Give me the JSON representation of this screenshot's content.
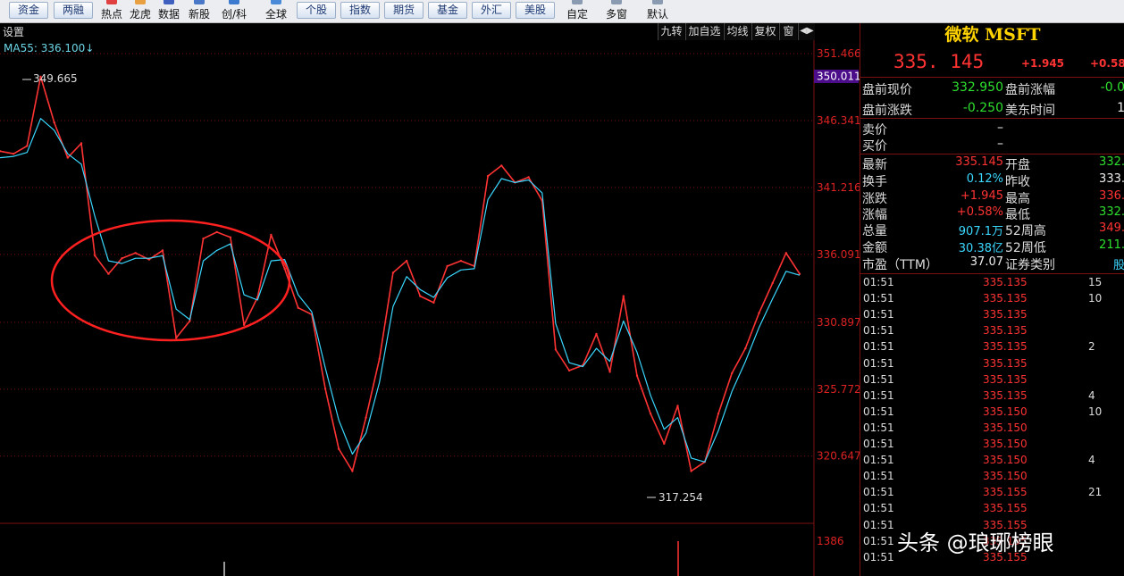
{
  "toolbar": {
    "buttons": [
      "资金",
      "两融"
    ],
    "icons": [
      {
        "label": "热点",
        "icon": "hotspot-icon",
        "color": "#e04040"
      },
      {
        "label": "龙虎",
        "icon": "dragon-tiger-icon",
        "color": "#e8a040"
      },
      {
        "label": "数据",
        "icon": "data-icon",
        "color": "#4060c0"
      },
      {
        "label": "新股",
        "icon": "new-stock-icon",
        "color": "#4a78c8"
      },
      {
        "label": "创/科",
        "icon": "tech-board-icon",
        "color": "#3c7ad0"
      },
      {
        "label": "全球",
        "icon": "globe-icon",
        "color": "#4a8ad8"
      }
    ],
    "market_buttons": [
      "个股",
      "指数",
      "期货",
      "基金",
      "外汇",
      "美股"
    ],
    "right_icons": [
      {
        "label": "自定",
        "icon": "custom-icon"
      },
      {
        "label": "多窗",
        "icon": "multi-window-icon"
      },
      {
        "label": "默认",
        "icon": "default-icon"
      }
    ]
  },
  "chart": {
    "settings_label": "设置",
    "ma_label": "MA55: 336.100↓",
    "controls": [
      "九转",
      "加自选",
      "均线",
      "复权",
      "窗",
      "◀▶"
    ],
    "high_marker": "349.665",
    "low_marker": "317.254",
    "y_tick_labels": [
      "351.466",
      "346.341",
      "341.216",
      "336.091",
      "330.897",
      "325.772",
      "320.647"
    ],
    "current_price_tag": "350.011",
    "volume_label": "1386",
    "colors": {
      "up": "#ff3333",
      "ma": "#3ad8ff",
      "grid": "#7a0f0f",
      "circle": "#ff2020"
    }
  },
  "chart_data": {
    "type": "line",
    "y_axis_ticks": [
      351.466,
      346.341,
      341.216,
      336.091,
      330.897,
      325.772,
      320.647
    ],
    "ylim": [
      315.5,
      352.5
    ],
    "series": [
      {
        "name": "",
        "values": [
          344.0,
          343.8,
          344.4,
          349.7,
          346.2,
          343.5,
          344.6,
          336.0,
          334.6,
          335.8,
          336.2,
          335.7,
          336.4,
          329.7,
          331.0,
          337.3,
          337.8,
          337.4,
          330.7,
          332.8,
          337.6,
          335.0,
          332.0,
          331.5,
          325.8,
          321.2,
          319.5,
          323.6,
          328.1,
          334.7,
          335.6,
          332.9,
          332.4,
          335.2,
          335.6,
          335.2,
          342.1,
          342.9,
          341.6,
          342.0,
          340.2,
          328.8,
          327.2,
          327.6,
          330.0,
          327.1,
          332.9,
          326.8,
          323.9,
          321.6,
          324.5,
          319.5,
          320.2,
          323.9,
          327.0,
          328.9,
          331.6,
          333.9,
          336.2,
          334.6
        ]
      },
      {
        "name": "MA55",
        "values": [
          343.5,
          343.6,
          343.9,
          346.5,
          345.6,
          343.8,
          343.0,
          339.0,
          335.6,
          335.4,
          335.8,
          335.8,
          336.0,
          331.9,
          331.1,
          335.6,
          336.4,
          336.9,
          333.0,
          332.6,
          335.6,
          335.7,
          333.0,
          331.7,
          327.4,
          323.4,
          320.8,
          322.4,
          326.3,
          332.1,
          334.4,
          333.4,
          332.8,
          334.3,
          334.9,
          335.0,
          340.3,
          341.9,
          341.6,
          341.8,
          340.8,
          330.8,
          327.8,
          327.5,
          328.9,
          327.9,
          331.0,
          328.6,
          325.3,
          322.7,
          323.6,
          320.5,
          320.2,
          322.6,
          325.6,
          327.9,
          330.5,
          332.7,
          334.8,
          334.5
        ]
      }
    ],
    "annotations": [
      "349.665",
      "317.254"
    ]
  },
  "quote": {
    "title": "微软 MSFT",
    "price": "335. 145",
    "change": "+1.945",
    "change_pct": "+0.58",
    "premarket": [
      {
        "k1": "盘前现价",
        "v1": "332.950",
        "k2": "盘前涨幅",
        "v2": "-0.0"
      },
      {
        "k1": "盘前涨跌",
        "v1": "-0.250",
        "k2": "美东时间",
        "v2": "1"
      }
    ],
    "bidask": [
      {
        "k": "卖价",
        "v": "–"
      },
      {
        "k": "买价",
        "v": "–"
      }
    ],
    "stats": [
      {
        "k1": "最新",
        "v1": "335.145",
        "c1": "red",
        "k2": "开盘",
        "v2": "332.",
        "c2": "green"
      },
      {
        "k1": "换手",
        "v1": "0.12%",
        "c1": "cyan",
        "k2": "昨收",
        "v2": "333.",
        "c2": "white"
      },
      {
        "k1": "涨跌",
        "v1": "+1.945",
        "c1": "red",
        "k2": "最高",
        "v2": "336.",
        "c2": "red"
      },
      {
        "k1": "涨幅",
        "v1": "+0.58%",
        "c1": "red",
        "k2": "最低",
        "v2": "332.",
        "c2": "green"
      },
      {
        "k1": "总量",
        "v1": "907.1万",
        "c1": "cyan",
        "k2": "52周高",
        "v2": "349.",
        "c2": "red"
      },
      {
        "k1": "金额",
        "v1": "30.38亿",
        "c1": "cyan",
        "k2": "52周低",
        "v2": "211.",
        "c2": "green"
      },
      {
        "k1": "市盈（TTM）",
        "v1": "37.07",
        "c1": "white",
        "k2": "证券类别",
        "v2": "股",
        "c2": "cyan"
      }
    ],
    "ticks": [
      {
        "time": "01:51",
        "price": "335.135",
        "vol": "15"
      },
      {
        "time": "01:51",
        "price": "335.135",
        "vol": "10"
      },
      {
        "time": "01:51",
        "price": "335.135",
        "vol": ""
      },
      {
        "time": "01:51",
        "price": "335.135",
        "vol": ""
      },
      {
        "time": "01:51",
        "price": "335.135",
        "vol": "2"
      },
      {
        "time": "01:51",
        "price": "335.135",
        "vol": ""
      },
      {
        "time": "01:51",
        "price": "335.135",
        "vol": ""
      },
      {
        "time": "01:51",
        "price": "335.135",
        "vol": "4"
      },
      {
        "time": "01:51",
        "price": "335.150",
        "vol": "10"
      },
      {
        "time": "01:51",
        "price": "335.150",
        "vol": ""
      },
      {
        "time": "01:51",
        "price": "335.150",
        "vol": ""
      },
      {
        "time": "01:51",
        "price": "335.150",
        "vol": "4"
      },
      {
        "time": "01:51",
        "price": "335.150",
        "vol": ""
      },
      {
        "time": "01:51",
        "price": "335.155",
        "vol": "21"
      },
      {
        "time": "01:51",
        "price": "335.155",
        "vol": ""
      },
      {
        "time": "01:51",
        "price": "335.155",
        "vol": ""
      },
      {
        "time": "01:51",
        "price": "335.155",
        "vol": ""
      },
      {
        "time": "01:51",
        "price": "335.155",
        "vol": ""
      }
    ]
  },
  "watermark": "头条 @琅琊榜眼"
}
